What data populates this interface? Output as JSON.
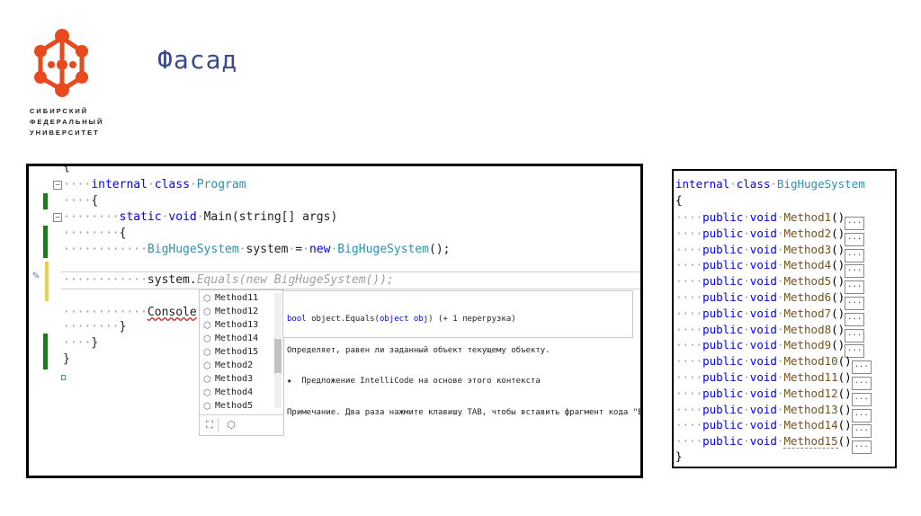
{
  "slide": {
    "title": "Фасад",
    "university": [
      "СИБИРСКИЙ",
      "ФЕДЕРАЛЬНЫЙ",
      "УНИВЕРСИТЕТ"
    ],
    "brand_color": "#e8491d"
  },
  "left_code": {
    "line0": "{",
    "line1_kw": "internal",
    "line1_kw2": "class",
    "line1_type": "Program",
    "line2": "{",
    "line3_kw": "static",
    "line3_kw2": "void",
    "line3_name": "Main",
    "line3_args": "(string[] args)",
    "line4": "{",
    "line5_type": "BigHugeSystem",
    "line5_mid": "system",
    "line5_eq": "=",
    "line5_new": "new",
    "line5_type2": "BigHugeSystem",
    "line5_end": "();",
    "line6_obj": "system.",
    "line6_ghost": "Equals(new BigHugeSystem());",
    "line7": "Console",
    "line8": "}",
    "line9": "}",
    "line10": "}"
  },
  "autocomplete": {
    "items": [
      "Method11",
      "Method12",
      "Method13",
      "Method14",
      "Method15",
      "Method2",
      "Method3",
      "Method4",
      "Method5"
    ]
  },
  "tooltip": {
    "sig_type": "bool",
    "sig_name": "object.Equals(",
    "sig_param": "object obj",
    "sig_rest": ") (+ 1 перегрузка)",
    "line2": "Определяет, равен ли заданный объект текущему объекту.",
    "line3": "★  Предложение IntelliCode на основе этого контекста",
    "line4": "Примечание. Два раза нажмите клавишу TAB, чтобы вставить фрагмент кода \"Equals\"."
  },
  "right_code": {
    "header_kw": "internal",
    "header_kw2": "class",
    "header_type": "BigHugeSystem",
    "open": "{",
    "close": "}",
    "public": "public",
    "void": "void",
    "parens": "()",
    "ellipsis": "...",
    "methods": [
      "Method1",
      "Method2",
      "Method3",
      "Method4",
      "Method5",
      "Method6",
      "Method7",
      "Method8",
      "Method9",
      "Method10",
      "Method11",
      "Method12",
      "Method13",
      "Method14",
      "Method15"
    ]
  }
}
